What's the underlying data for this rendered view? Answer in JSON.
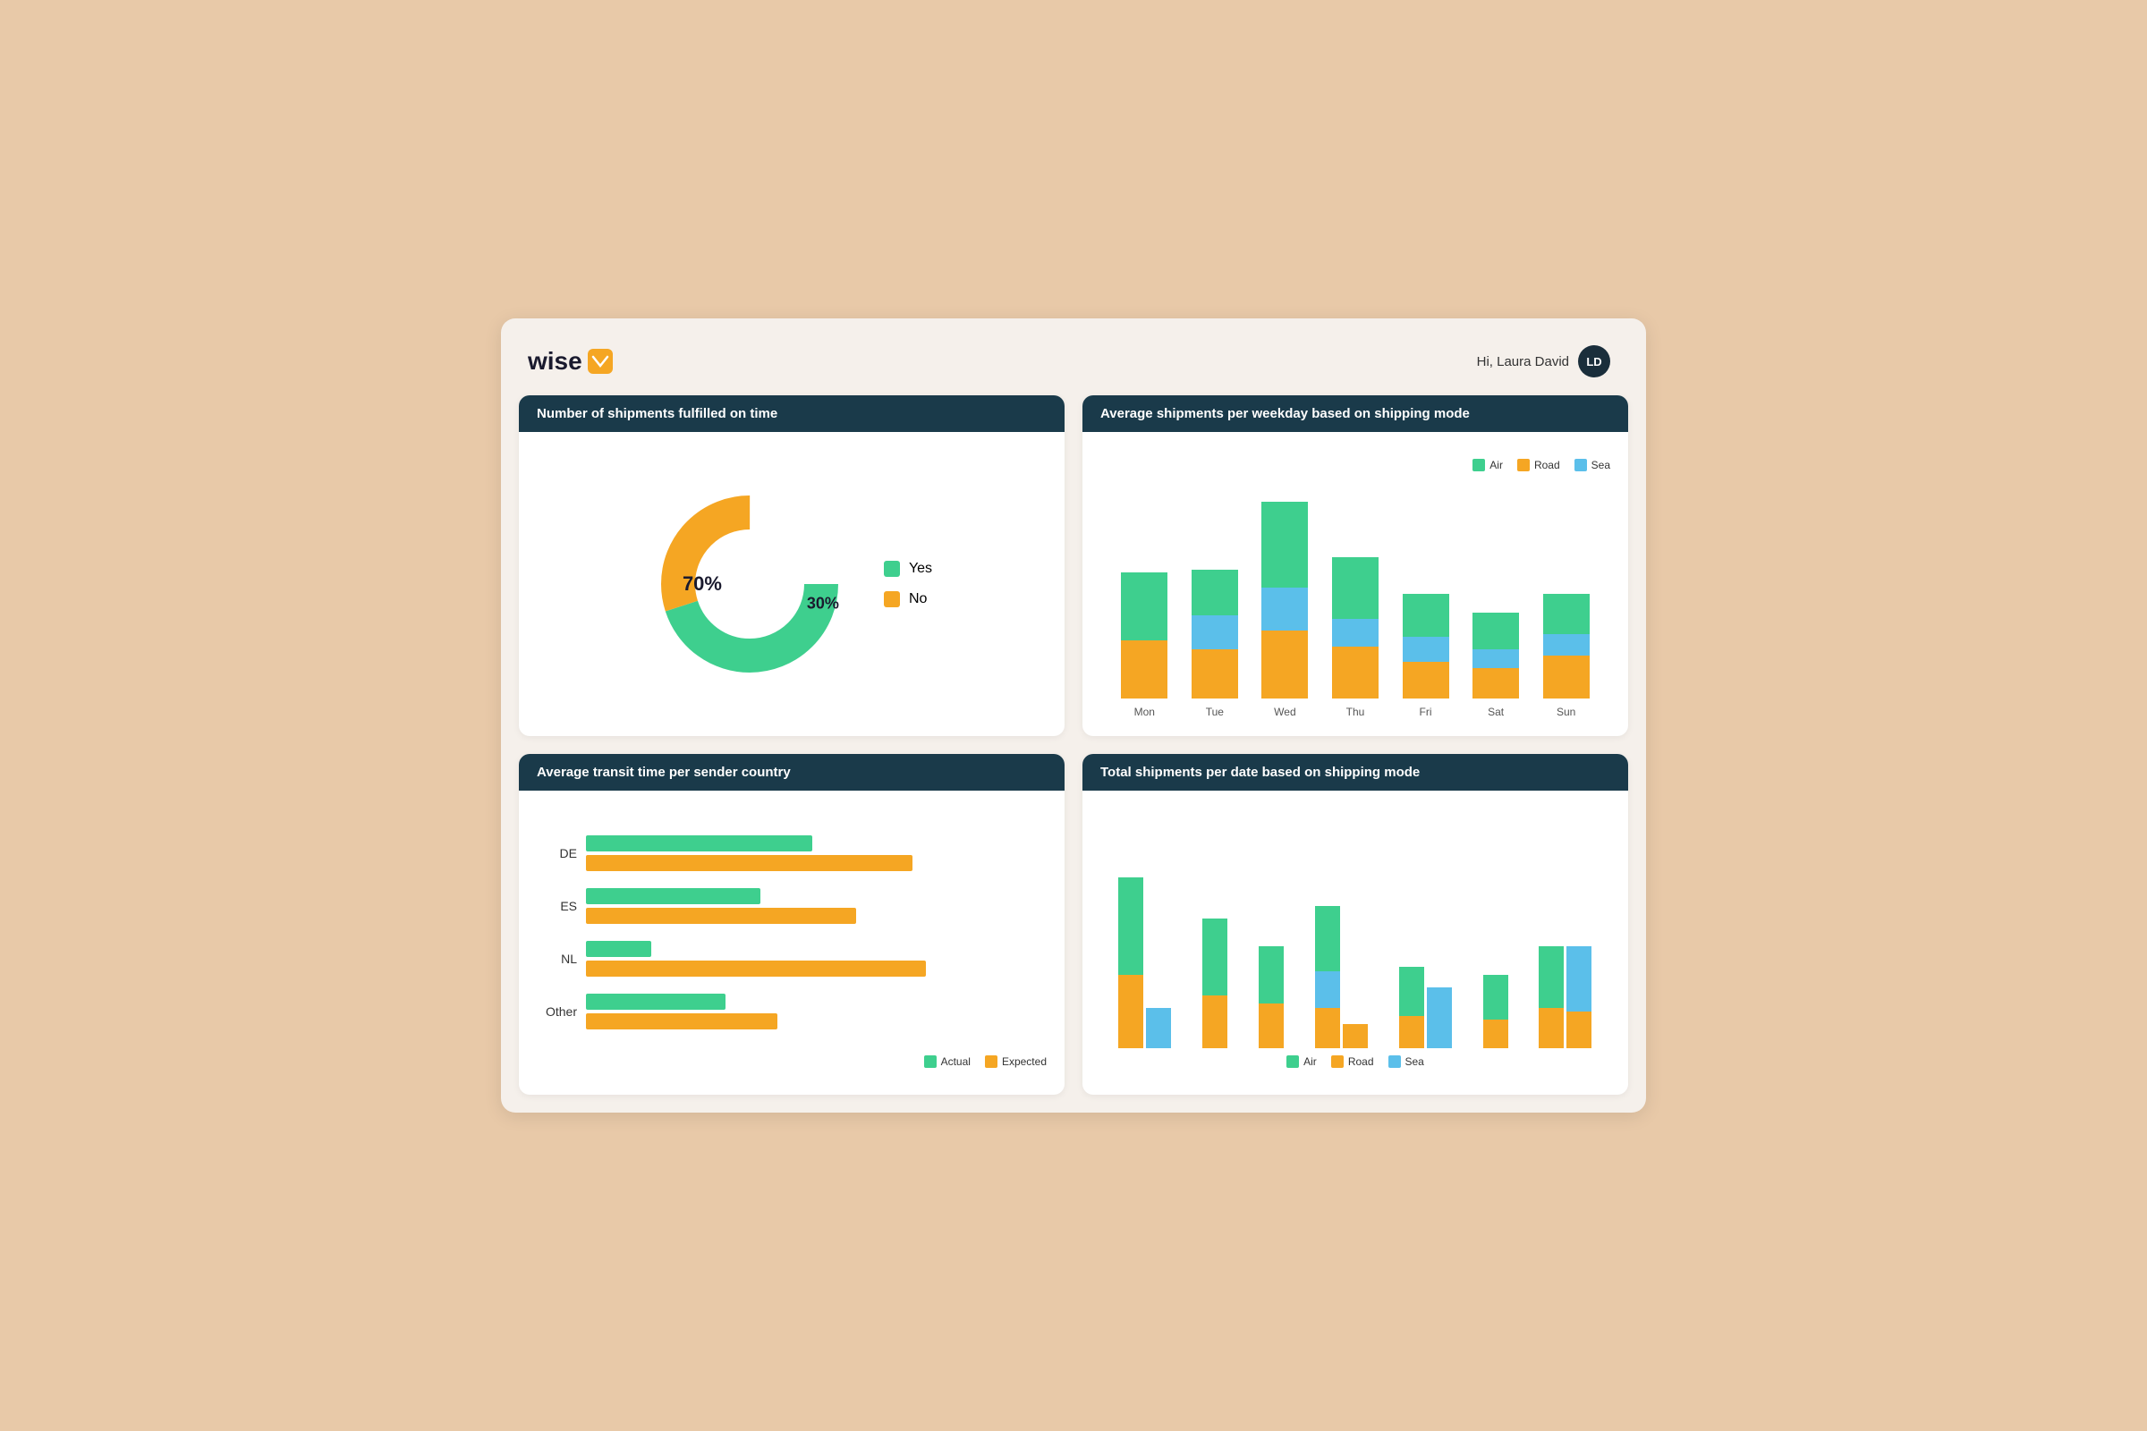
{
  "app": {
    "logo_text": "wise",
    "logo_icon": "BI",
    "user_greeting": "Hi, Laura David",
    "user_initials": "LD"
  },
  "charts": {
    "donut": {
      "title": "Number of shipments fulfilled on time",
      "yes_pct": 70,
      "no_pct": 30,
      "yes_label": "Yes",
      "no_label": "No",
      "color_yes": "#3ecf8e",
      "color_no": "#f5a623"
    },
    "weekday_bar": {
      "title": "Average shipments per weekday based on shipping mode",
      "legend": [
        "Air",
        "Road",
        "Sea"
      ],
      "colors": {
        "Air": "#3ecf8e",
        "Road": "#f5a623",
        "Sea": "#5bbfea"
      },
      "days": [
        "Mon",
        "Tue",
        "Wed",
        "Thu",
        "Fri",
        "Sat",
        "Sun"
      ],
      "data": [
        {
          "day": "Mon",
          "Air": 110,
          "Road": 95,
          "Sea": 0
        },
        {
          "day": "Tue",
          "Air": 75,
          "Road": 80,
          "Sea": 55
        },
        {
          "day": "Wed",
          "Air": 140,
          "Road": 110,
          "Sea": 70
        },
        {
          "day": "Thu",
          "Air": 100,
          "Road": 85,
          "Sea": 45
        },
        {
          "day": "Fri",
          "Air": 70,
          "Road": 60,
          "Sea": 40
        },
        {
          "day": "Sat",
          "Air": 60,
          "Road": 50,
          "Sea": 30
        },
        {
          "day": "Sun",
          "Air": 65,
          "Road": 70,
          "Sea": 35
        }
      ]
    },
    "transit_time": {
      "title": "Average transit time per sender country",
      "countries": [
        "DE",
        "ES",
        "NL",
        "Other"
      ],
      "color_actual": "#3ecf8e",
      "color_expected": "#f5a623",
      "actual_label": "Actual",
      "expected_label": "Expected",
      "data": [
        {
          "country": "DE",
          "actual": 52,
          "expected": 75
        },
        {
          "country": "ES",
          "actual": 40,
          "expected": 62
        },
        {
          "country": "NL",
          "actual": 15,
          "expected": 78
        },
        {
          "country": "Other",
          "actual": 32,
          "expected": 44
        }
      ]
    },
    "total_shipments": {
      "title": "Total shipments per date based on shipping mode",
      "legend": [
        "Air",
        "Road",
        "Sea"
      ],
      "colors": {
        "Air": "#3ecf8e",
        "Road": "#f5a623",
        "Sea": "#5bbfea"
      },
      "groups": [
        {
          "bars": [
            {
              "Air": 120,
              "Road": 90,
              "Sea": 0
            },
            {
              "Air": 0,
              "Road": 0,
              "Sea": 50
            }
          ]
        },
        {
          "bars": [
            {
              "Air": 95,
              "Road": 60,
              "Sea": 0
            },
            {
              "Air": 0,
              "Road": 0,
              "Sea": 0
            }
          ]
        },
        {
          "bars": [
            {
              "Air": 70,
              "Road": 55,
              "Sea": 0
            },
            {
              "Air": 0,
              "Road": 0,
              "Sea": 0
            }
          ]
        },
        {
          "bars": [
            {
              "Air": 80,
              "Road": 50,
              "Sea": 45
            },
            {
              "Air": 0,
              "Road": 30,
              "Sea": 0
            }
          ]
        },
        {
          "bars": [
            {
              "Air": 60,
              "Road": 40,
              "Sea": 0
            },
            {
              "Air": 0,
              "Road": 0,
              "Sea": 75
            }
          ]
        },
        {
          "bars": [
            {
              "Air": 55,
              "Road": 35,
              "Sea": 0
            },
            {
              "Air": 0,
              "Road": 0,
              "Sea": 0
            }
          ]
        },
        {
          "bars": [
            {
              "Air": 75,
              "Road": 50,
              "Sea": 0
            },
            {
              "Air": 0,
              "Road": 45,
              "Sea": 80
            }
          ]
        }
      ]
    }
  }
}
